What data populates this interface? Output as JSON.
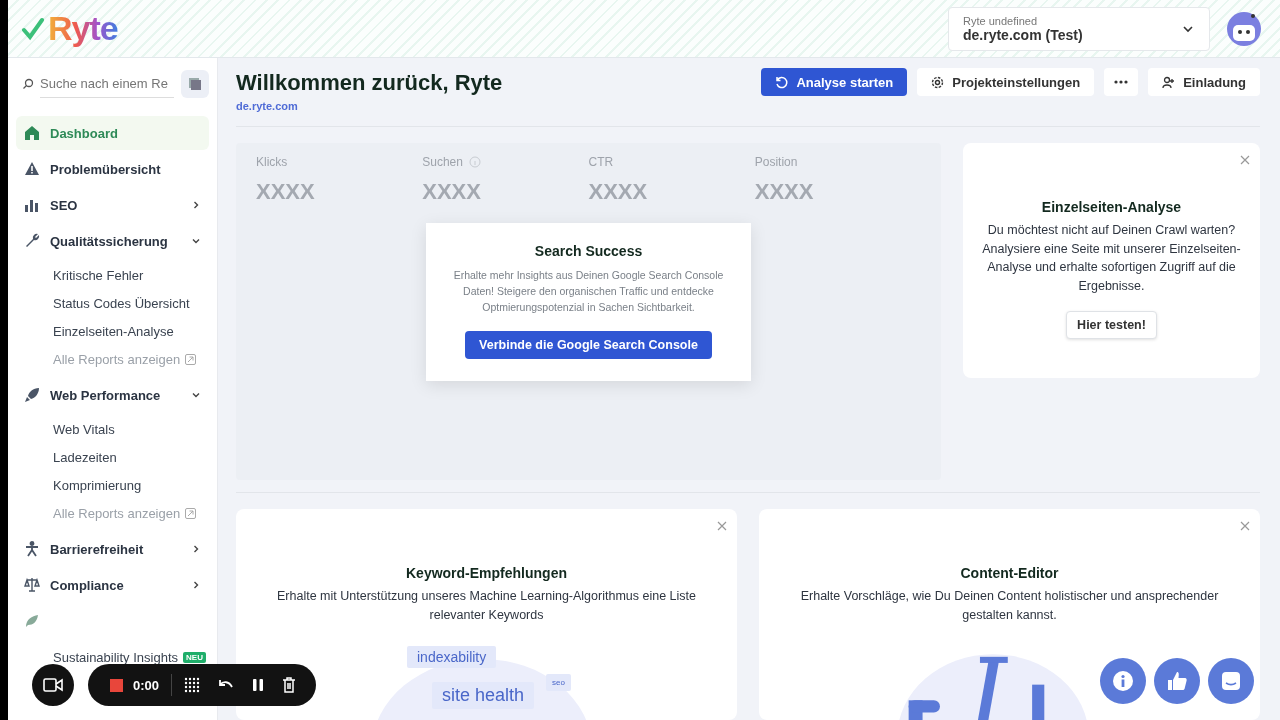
{
  "header": {
    "logo": "Ryte",
    "project_label": "Ryte undefined",
    "project": "de.ryte.com (Test)"
  },
  "sidebar": {
    "search": {
      "placeholder": "Suche nach einem Re"
    },
    "items": [
      {
        "label": "Dashboard",
        "selected": true
      },
      {
        "label": "Problemübersicht",
        "selected": false
      },
      {
        "label": "SEO",
        "selected": false,
        "expanded": false
      },
      {
        "label": "Qualitätssicherung",
        "selected": false,
        "expanded": true,
        "children": [
          {
            "label": "Kritische Fehler",
            "kind": "page"
          },
          {
            "label": "Status Codes Übersicht",
            "kind": "page"
          },
          {
            "label": "Einzelseiten-Analyse",
            "kind": "page"
          },
          {
            "label": "Alle Reports anzeigen",
            "kind": "link"
          }
        ]
      },
      {
        "label": "Web Performance",
        "selected": false,
        "expanded": true,
        "children": [
          {
            "label": "Web Vitals",
            "kind": "page"
          },
          {
            "label": "Ladezeiten",
            "kind": "page"
          },
          {
            "label": "Komprimierung",
            "kind": "page"
          },
          {
            "label": "Alle Reports anzeigen",
            "kind": "link"
          }
        ]
      },
      {
        "label": "Barrierefreiheit",
        "selected": false,
        "expanded": false
      },
      {
        "label": "Compliance",
        "selected": false,
        "expanded": false
      },
      {
        "selected": false,
        "children": [
          {
            "label": "Sustainability Insights",
            "kind": "page",
            "badge": "NEU"
          }
        ]
      }
    ]
  },
  "page": {
    "title": "Willkommen zurück, Ryte",
    "domain": "de.ryte.com",
    "actions": [
      {
        "label": "Analyse starten",
        "kind": "primary"
      },
      {
        "label": "Projekteinstellungen",
        "kind": "secondary"
      },
      {
        "kind": "more"
      },
      {
        "label": "Einladung",
        "kind": "secondary"
      }
    ]
  },
  "metrics": [
    {
      "label": "Klicks",
      "value": "XXXX",
      "info": false
    },
    {
      "label": "Suchen",
      "value": "XXXX",
      "info": true
    },
    {
      "label": "CTR",
      "value": "XXXX",
      "info": false
    },
    {
      "label": "Position",
      "value": "XXXX",
      "info": false
    }
  ],
  "popup": {
    "title": "Search Success",
    "text": "Erhalte mehr Insights aus Deinen Google Search Console Daten! Steigere den organischen Traffic und entdecke Optmierungspotenzial in Sachen Sichtbarkeit.",
    "button": "Verbinde die Google Search Console"
  },
  "single_page_card": {
    "title": "Einzelseiten-Analyse",
    "text": "Du möchtest nicht auf Deinen Crawl warten? Analysiere eine Seite mit unserer Einzelseiten-Analyse und erhalte sofortigen Zugriff auf die Ergebnisse.",
    "button": "Hier testen!"
  },
  "feature_cards": [
    {
      "kind": "keywords",
      "title": "Keyword-Empfehlungen",
      "text": "Erhalte mit Unterstützung unseres Machine Learning-Algorithmus eine Liste relevanter Keywords",
      "tags": [
        "indexability",
        "site health",
        "seo"
      ]
    },
    {
      "kind": "editor",
      "title": "Content-Editor",
      "text": "Erhalte Vorschläge, wie Du Deinen Content holistischer und ansprechender gestalten kannst."
    }
  ],
  "recorder": {
    "time": "0:00"
  }
}
